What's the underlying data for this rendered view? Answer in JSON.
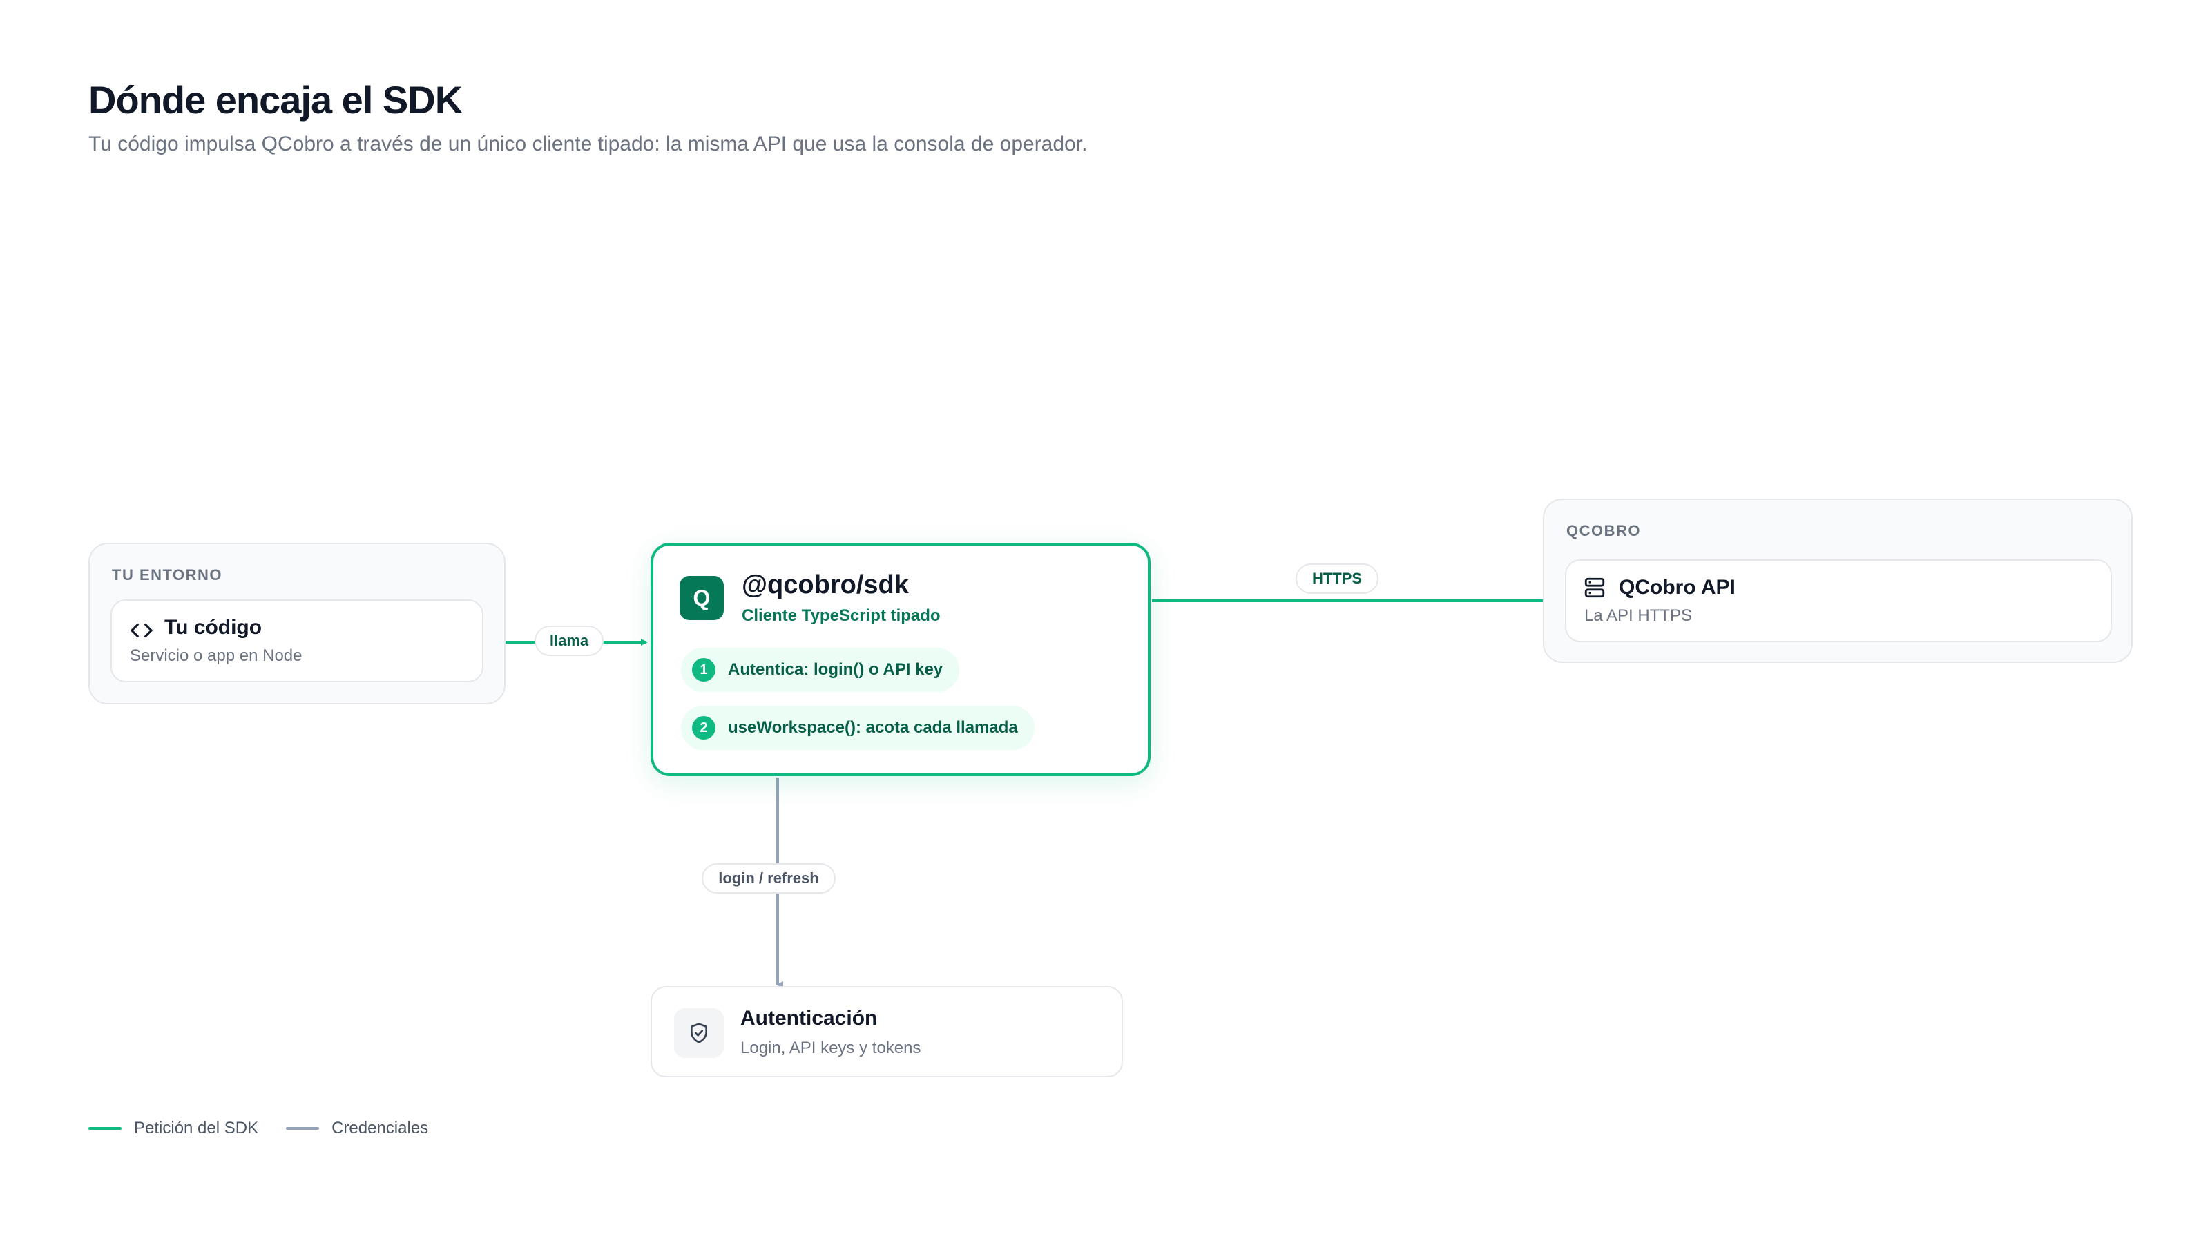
{
  "header": {
    "title": "Dónde encaja el SDK",
    "subtitle": "Tu código impulsa QCobro a través de un único cliente tipado: la misma API que usa la consola de operador."
  },
  "groups": {
    "env": {
      "label": "TU ENTORNO"
    },
    "qcobro": {
      "label": "QCOBRO"
    }
  },
  "nodes": {
    "code": {
      "title": "Tu código",
      "subtitle": "Servicio o app en Node",
      "icon": "code-icon"
    },
    "sdk": {
      "logo": "Q",
      "title": "@qcobro/sdk",
      "subtitle": "Cliente TypeScript tipado",
      "steps": [
        {
          "num": "1",
          "text": "Autentica: login() o API key"
        },
        {
          "num": "2",
          "text": "useWorkspace(): acota cada llamada"
        }
      ]
    },
    "api": {
      "title": "QCobro API",
      "subtitle": "La API HTTPS",
      "icon": "server-icon"
    },
    "auth": {
      "title": "Autenticación",
      "subtitle": "Login, API keys y tokens",
      "icon": "shield-check-icon"
    }
  },
  "edges": {
    "calls": "llama",
    "https": "HTTPS",
    "credentials": "login / refresh"
  },
  "legend": {
    "request": "Petición del SDK",
    "credentials": "Credenciales"
  },
  "colors": {
    "accent": "#10b981",
    "accent_dark": "#047857",
    "credentials_line": "#94a3b8"
  }
}
